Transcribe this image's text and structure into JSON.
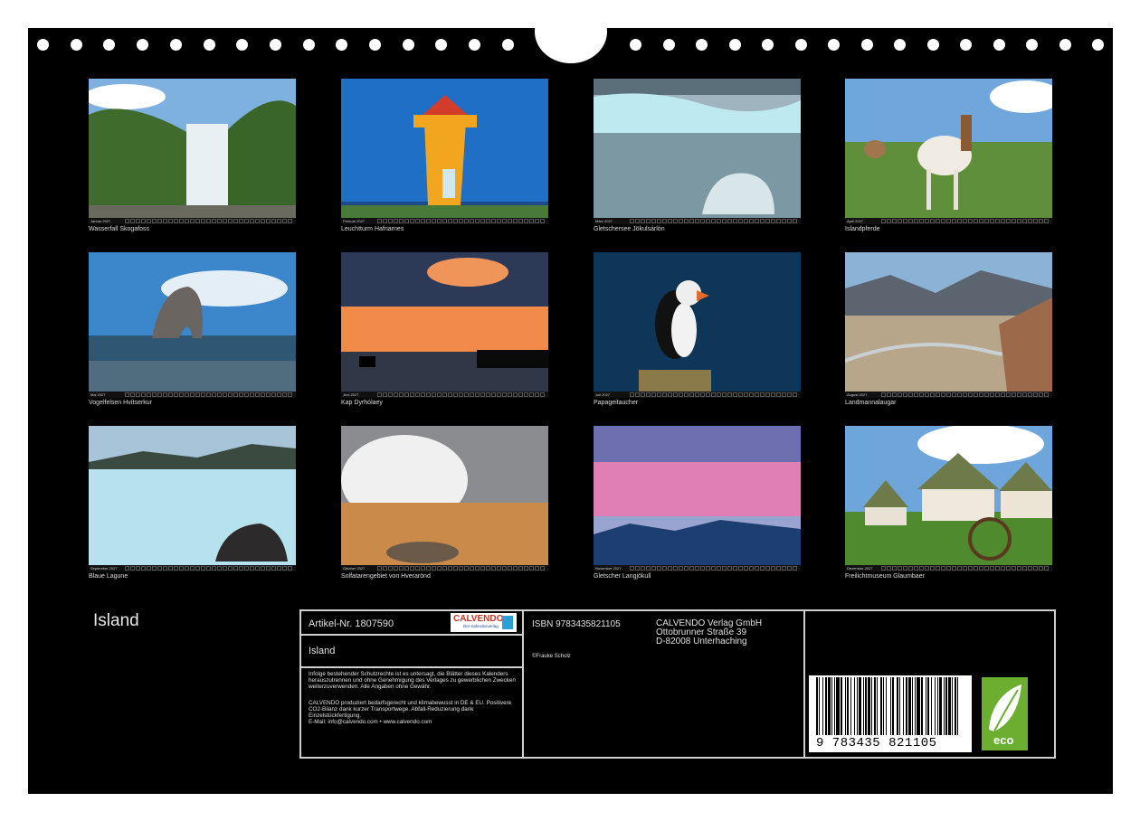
{
  "photos": [
    {
      "caption": "Wasserfall Skogafoss",
      "month": "Januar 2027"
    },
    {
      "caption": "Leuchtturm Hafnarnes",
      "month": "Februar 2027"
    },
    {
      "caption": "Gletschersee Jökulsárlón",
      "month": "März 2027"
    },
    {
      "caption": "Islandpferde",
      "month": "April 2027"
    },
    {
      "caption": "Vogelfelsen Hvítserkur",
      "month": "Mai 2027"
    },
    {
      "caption": "Kap Dyrhólaey",
      "month": "Juni 2027"
    },
    {
      "caption": "Papageitaucher",
      "month": "Juli 2027"
    },
    {
      "caption": "Landmannalaugar",
      "month": "August 2027"
    },
    {
      "caption": "Blaue Lagune",
      "month": "September 2027"
    },
    {
      "caption": "Solfatarengebiet von Hverarönd",
      "month": "Oktober 2027"
    },
    {
      "caption": "Gletscher Langjökull",
      "month": "November 2027"
    },
    {
      "caption": "Freilichtmuseum Glaumbaer",
      "month": "Dezember 2027"
    }
  ],
  "calendar_title": "Island",
  "info": {
    "article": "Artikel-Nr. 1807590",
    "logo": "CALVENDO",
    "logo_sub": "Der Kalenderverlag",
    "name": "Island",
    "legal": "Infolge bestehender Schutzrechte ist es untersagt, die Blätter dieses Kalenders herauszutrennen und ohne Genehmigung des Verlages zu gewerblichen Zwecken weiterzuverwenden. Alle Angaben ohne Gewähr.",
    "legal2": "CALVENDO produziert bedarfsgerecht und klimabewusst in DE & EU. Positivere CO2-Bilanz dank kurzer Transportwege. Abfall-Reduzierung dank Einzelstückfertigung.",
    "email": "E-Mail: info@calvendo.com • www.calvendo.com",
    "isbn": "ISBN 9783435821105",
    "publisher": [
      "CALVENDO Verlag GmbH",
      "Ottobrunner Straße 39",
      "D-82008 Unterhaching"
    ],
    "copyright": "©Frauke Scholz",
    "barcode_digits": "9 783435 821105",
    "eco_label": "eco"
  }
}
